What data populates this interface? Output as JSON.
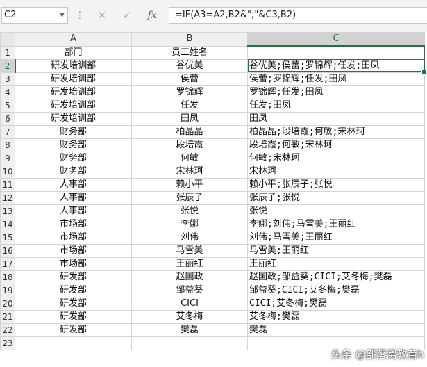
{
  "formula_bar": {
    "name_box": "C2",
    "fx_label": "fx",
    "formula": "=IF(A3=A2,B2&\";\"&C3,B2)"
  },
  "columns": [
    "A",
    "B",
    "C"
  ],
  "rows": [
    {
      "num": "1",
      "a": "部门",
      "b": "员工姓名",
      "c": ""
    },
    {
      "num": "2",
      "a": "研发培训部",
      "b": "谷优美",
      "c": "谷优美;侯蕾;罗锦辉;任发;田凤"
    },
    {
      "num": "3",
      "a": "研发培训部",
      "b": "侯蕾",
      "c": "侯蕾;罗锦辉;任发;田凤"
    },
    {
      "num": "4",
      "a": "研发培训部",
      "b": "罗锦辉",
      "c": "罗锦辉;任发;田凤"
    },
    {
      "num": "5",
      "a": "研发培训部",
      "b": "任发",
      "c": "任发;田凤"
    },
    {
      "num": "6",
      "a": "研发培训部",
      "b": "田凤",
      "c": "田凤"
    },
    {
      "num": "7",
      "a": "财务部",
      "b": "柏晶晶",
      "c": "柏晶晶;段培霞;何敏;宋林珂"
    },
    {
      "num": "8",
      "a": "财务部",
      "b": "段培霞",
      "c": "段培霞;何敏;宋林珂"
    },
    {
      "num": "9",
      "a": "财务部",
      "b": "何敏",
      "c": "何敏;宋林珂"
    },
    {
      "num": "10",
      "a": "财务部",
      "b": "宋林珂",
      "c": "宋林珂"
    },
    {
      "num": "11",
      "a": "人事部",
      "b": "赖小平",
      "c": "赖小平;张辰子;张悦"
    },
    {
      "num": "12",
      "a": "人事部",
      "b": "张辰子",
      "c": "张辰子;张悦"
    },
    {
      "num": "13",
      "a": "人事部",
      "b": "张悦",
      "c": "张悦"
    },
    {
      "num": "14",
      "a": "市场部",
      "b": "李娜",
      "c": "李娜;刘伟;马雪美;王丽红"
    },
    {
      "num": "15",
      "a": "市场部",
      "b": "刘伟",
      "c": "刘伟;马雪美;王丽红"
    },
    {
      "num": "16",
      "a": "市场部",
      "b": "马雪美",
      "c": "马雪美;王丽红"
    },
    {
      "num": "17",
      "a": "市场部",
      "b": "王丽红",
      "c": "王丽红"
    },
    {
      "num": "18",
      "a": "研发部",
      "b": "赵国政",
      "c": "赵国政;邹益葵;CICI;艾冬梅;樊磊"
    },
    {
      "num": "19",
      "a": "研发部",
      "b": "邹益葵",
      "c": "邹益葵;CICI;艾冬梅;樊磊"
    },
    {
      "num": "20",
      "a": "研发部",
      "b": "CICI",
      "c": "CICI;艾冬梅;樊磊"
    },
    {
      "num": "21",
      "a": "研发部",
      "b": "艾冬梅",
      "c": "艾冬梅;樊磊"
    },
    {
      "num": "22",
      "a": "研发部",
      "b": "樊磊",
      "c": "樊磊"
    },
    {
      "num": "23",
      "a": "",
      "b": "",
      "c": ""
    }
  ],
  "watermark": "头条 @部落窝教育h",
  "colors": {
    "accent": "#217346"
  }
}
